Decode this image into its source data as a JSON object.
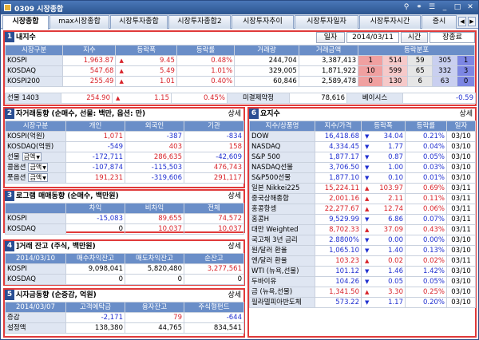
{
  "window": {
    "title": "0309 시장종합"
  },
  "tabs": [
    "시장종합",
    "max시장종합",
    "시장투자종합",
    "시장투자종합2",
    "시장투자추이",
    "시장투자일자",
    "시장투자시간",
    "증시"
  ],
  "p1": {
    "num": "1",
    "title": "내지수",
    "date_label": "일자",
    "date": "2014/03/11",
    "time_label": "시간",
    "time_value": "장종료",
    "headers": [
      "시장구분",
      "지수",
      "등락폭",
      "등락률",
      "거래량",
      "거래금액",
      "등락분포"
    ],
    "rows": [
      {
        "name": "KOSPI",
        "value": "1,963.87",
        "dir": "up",
        "chg": "9.45",
        "pct": "0.48%",
        "vol": "244,704",
        "amt": "3,387,413",
        "dist": [
          "1",
          "514",
          "59",
          "305",
          "1"
        ]
      },
      {
        "name": "KOSDAQ",
        "value": "547.68",
        "dir": "up",
        "chg": "5.49",
        "pct": "1.01%",
        "vol": "329,005",
        "amt": "1,871,922",
        "dist": [
          "10",
          "599",
          "65",
          "332",
          "3"
        ]
      },
      {
        "name": "KOSPI200",
        "value": "255.49",
        "dir": "up",
        "chg": "1.01",
        "pct": "0.40%",
        "vol": "60,846",
        "amt": "2,589,478",
        "dist": [
          "0",
          "130",
          "6",
          "63",
          "0"
        ]
      }
    ],
    "fut": {
      "name": "선물 1403",
      "value": "254.90",
      "dir": "up",
      "chg": "1.15",
      "pct": "0.45%",
      "oi_label": "미결제약정",
      "oi": "78,616",
      "basis_label": "베이시스",
      "basis": "-0.59"
    }
  },
  "p2": {
    "num": "2",
    "title": "자거래동향 (순매수, 선물: 백만, 옵션: 만)",
    "more": "상세",
    "headers": [
      "시장구분",
      "개인",
      "외국인",
      "기관"
    ],
    "rows": [
      {
        "name": "KOSPI(억원)",
        "sel": "",
        "a": "1,071",
        "b": "-387",
        "c": "-834"
      },
      {
        "name": "KOSDAQ(억원)",
        "sel": "",
        "a": "-549",
        "b": "403",
        "c": "158"
      },
      {
        "name": "선물",
        "sel": "금액",
        "a": "-172,711",
        "b": "286,635",
        "c": "-42,609"
      },
      {
        "name": "콜옵션",
        "sel": "금액",
        "a": "-107,874",
        "b": "-115,503",
        "c": "476,743"
      },
      {
        "name": "풋옵션",
        "sel": "금액",
        "a": "191,231",
        "b": "-319,606",
        "c": "291,117"
      }
    ]
  },
  "p3": {
    "num": "3",
    "title": "로그램 매매동향 (순매수, 백만원)",
    "more": "상세",
    "headers": [
      "",
      "차익",
      "비차익",
      "전체"
    ],
    "rows": [
      {
        "name": "KOSPI",
        "a": "-15,083",
        "b": "89,655",
        "c": "74,572"
      },
      {
        "name": "KOSDAQ",
        "a": "0",
        "b": "10,037",
        "c": "10,037"
      }
    ]
  },
  "p4": {
    "num": "4",
    "title": "]거래 잔고 (주식, 백만원)",
    "more": "상세",
    "headers": [
      "2014/03/10",
      "매수차익잔고",
      "매도차익잔고",
      "순잔고"
    ],
    "rows": [
      {
        "name": "KOSPI",
        "a": "9,098,041",
        "b": "5,820,480",
        "c": "3,277,561"
      },
      {
        "name": "KOSDAQ",
        "a": "0",
        "b": "0",
        "c": "0"
      }
    ]
  },
  "p5": {
    "num": "5",
    "title": "시자금동향 (순증감, 억원)",
    "more": "상세",
    "headers": [
      "2014/03/07",
      "고객예탁금",
      "융자잔고",
      "주식형펀드"
    ],
    "rows": [
      {
        "name": "증감",
        "a": "-2,171",
        "b": "79",
        "c": "-644"
      },
      {
        "name": "설정액",
        "a": "138,380",
        "b": "44,765",
        "c": "834,541"
      }
    ]
  },
  "p6": {
    "num": "6",
    "title": "요지수",
    "more": "상세",
    "headers": [
      "지수/상품명",
      "지수/가격",
      "등락폭",
      "등락률",
      "일자"
    ],
    "rows": [
      {
        "name": "DOW",
        "value": "16,418.68",
        "dir": "dn",
        "chg": "34.04",
        "pct": "0.21%",
        "date": "03/10"
      },
      {
        "name": "NASDAQ",
        "value": "4,334.45",
        "dir": "dn",
        "chg": "1.77",
        "pct": "0.04%",
        "date": "03/10"
      },
      {
        "name": "S&P 500",
        "value": "1,877.17",
        "dir": "dn",
        "chg": "0.87",
        "pct": "0.05%",
        "date": "03/10"
      },
      {
        "name": "NASDAQ선물",
        "value": "3,706.50",
        "dir": "dn",
        "chg": "1.00",
        "pct": "0.03%",
        "date": "03/10"
      },
      {
        "name": "S&P500선물",
        "value": "1,877.10",
        "dir": "dn",
        "chg": "0.10",
        "pct": "0.01%",
        "date": "03/10"
      },
      {
        "name": "일본 Nikkei225",
        "value": "15,224.11",
        "dir": "up",
        "chg": "103.97",
        "pct": "0.69%",
        "date": "03/11"
      },
      {
        "name": "중국상해종합",
        "value": "2,001.16",
        "dir": "up",
        "chg": "2.11",
        "pct": "0.11%",
        "date": "03/11"
      },
      {
        "name": "홍콩항셍",
        "value": "22,277.67",
        "dir": "up",
        "chg": "12.74",
        "pct": "0.06%",
        "date": "03/11"
      },
      {
        "name": "홍콩H",
        "value": "9,529.99",
        "dir": "dn",
        "chg": "6.86",
        "pct": "0.07%",
        "date": "03/11"
      },
      {
        "name": "대만 Weighted",
        "value": "8,702.33",
        "dir": "up",
        "chg": "37.09",
        "pct": "0.43%",
        "date": "03/11"
      },
      {
        "name": "국고채 3년 금리",
        "value": "2.8800%",
        "dir": "dn",
        "chg": "0.00",
        "pct": "0.00%",
        "date": "03/10"
      },
      {
        "name": "원/달러 환율",
        "value": "1,065.10",
        "dir": "dn",
        "chg": "1.40",
        "pct": "0.13%",
        "date": "03/10"
      },
      {
        "name": "엔/달러 환율",
        "value": "103.23",
        "dir": "up",
        "chg": "0.02",
        "pct": "0.02%",
        "date": "03/11"
      },
      {
        "name": "WTI (뉴욕,선물)",
        "value": "101.12",
        "dir": "dn",
        "chg": "1.46",
        "pct": "1.42%",
        "date": "03/10"
      },
      {
        "name": "두바이유",
        "value": "104.26",
        "dir": "dn",
        "chg": "0.05",
        "pct": "0.05%",
        "date": "03/10"
      },
      {
        "name": "금 (뉴욕,선물)",
        "value": "1,341.50",
        "dir": "up",
        "chg": "3.30",
        "pct": "0.25%",
        "date": "03/10"
      },
      {
        "name": "필라델피아반도체",
        "value": "573.22",
        "dir": "dn",
        "chg": "1.17",
        "pct": "0.20%",
        "date": "03/10"
      }
    ]
  },
  "colors": {
    "title_bar": "#2c558f",
    "header": "#6a8ec8",
    "panel_border": "#e03a3a",
    "up": "#d8232a",
    "down": "#1f2fd0"
  }
}
